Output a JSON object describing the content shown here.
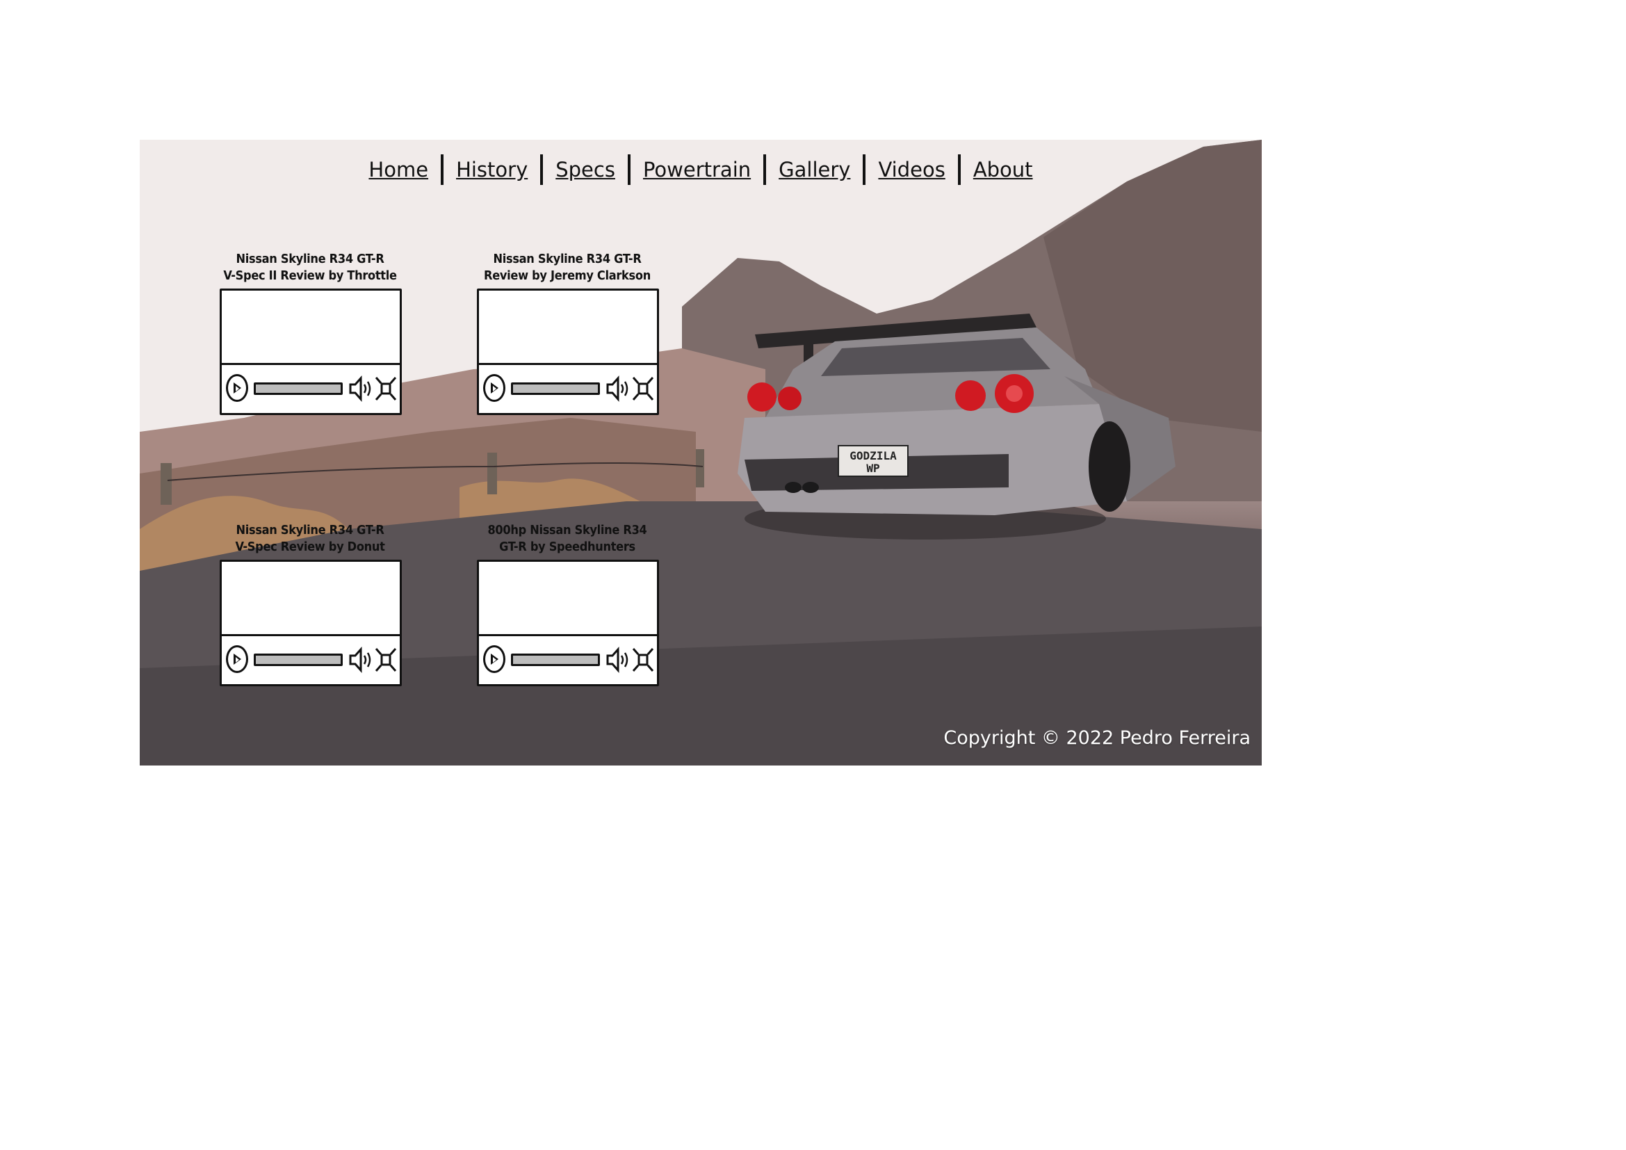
{
  "nav": {
    "items": [
      {
        "label": "Home"
      },
      {
        "label": "History"
      },
      {
        "label": "Specs"
      },
      {
        "label": "Powertrain"
      },
      {
        "label": "Gallery"
      },
      {
        "label": "Videos"
      },
      {
        "label": "About"
      }
    ]
  },
  "videos": [
    {
      "title": "Nissan Skyline R34 GT-R\nV-Spec II Review by Throttle"
    },
    {
      "title": "Nissan Skyline R34 GT-R\nReview by Jeremy Clarkson"
    },
    {
      "title": "Nissan Skyline R34 GT-R\nV-Spec Review by Donut"
    },
    {
      "title": "800hp Nissan Skyline R34\nGT-R by Speedhunters"
    }
  ],
  "car": {
    "plate_line1": "GODZILA",
    "plate_line2": "WP"
  },
  "footer": {
    "copyright": "Copyright © 2022 Pedro Ferreira"
  },
  "colors": {
    "text": "#111111",
    "footer_text": "#ffffff",
    "taillight": "#d01a22"
  }
}
